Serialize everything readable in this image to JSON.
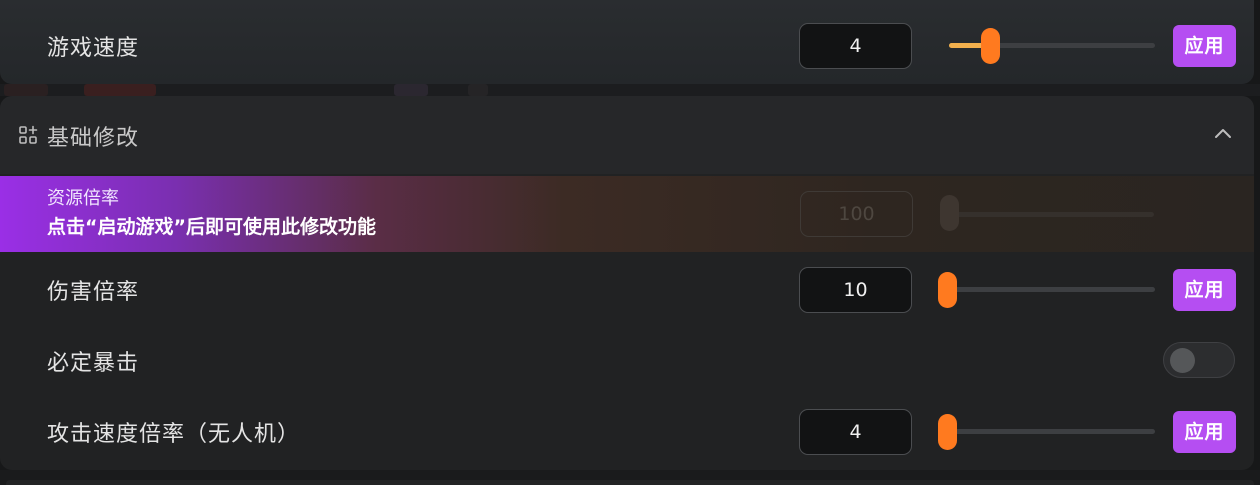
{
  "top_setting": {
    "label": "游戏速度",
    "value": "4",
    "slider_fraction": 0.2,
    "apply_label": "应用"
  },
  "section": {
    "title": "基础修改",
    "icon": "apps-add-icon",
    "collapse_icon": "chevron-up-icon"
  },
  "locked_setting": {
    "label": "资源倍率",
    "message": "点击“启动游戏”后即可使用此修改功能",
    "value": "100"
  },
  "rows": [
    {
      "label": "伤害倍率",
      "value": "10",
      "slider_fraction": 0.0,
      "apply_label": "应用"
    },
    {
      "label": "必定暴击",
      "toggle_on": false
    },
    {
      "label": "攻击速度倍率（无人机）",
      "value": "4",
      "slider_fraction": 0.0,
      "apply_label": "应用"
    }
  ],
  "colors": {
    "accent_purple": "#b54ef2",
    "slider_thumb": "#ff7a1f",
    "slider_fill": "#f2b04d"
  }
}
